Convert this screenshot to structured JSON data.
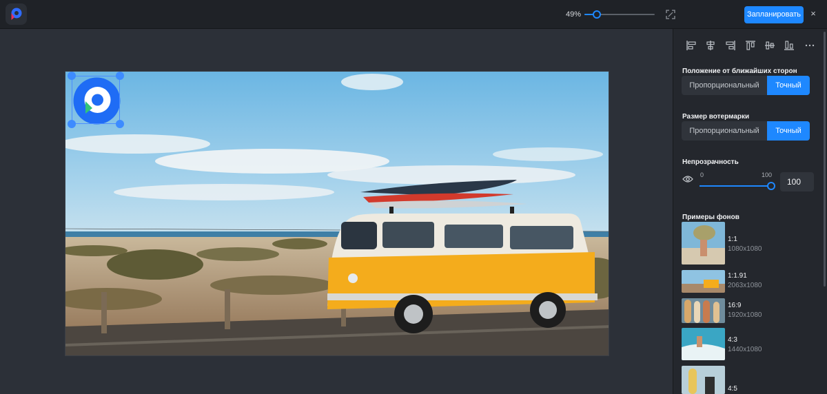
{
  "topbar": {
    "zoom": "49%",
    "zoom_fraction": 0.18,
    "schedule_label": "Запланировать",
    "close_label": "×"
  },
  "panel": {
    "position_title": "Положение от ближайших сторон",
    "position_options": [
      "Пропорциональный",
      "Точный"
    ],
    "position_selected": "Точный",
    "size_title": "Размер вотермарки",
    "size_options": [
      "Пропорциональный",
      "Точный"
    ],
    "size_selected": "Точный",
    "opacity_title": "Непрозрачность",
    "opacity_min": "0",
    "opacity_max": "100",
    "opacity_value": "100",
    "samples_title": "Примеры фонов",
    "samples": [
      {
        "ratio": "1:1",
        "dims": "1080x1080"
      },
      {
        "ratio": "1:1.91",
        "dims": "2063x1080"
      },
      {
        "ratio": "16:9",
        "dims": "1920x1080"
      },
      {
        "ratio": "4:3",
        "dims": "1440x1080"
      },
      {
        "ratio": "4:5",
        "dims": ""
      }
    ]
  },
  "colors": {
    "accent": "#1e88ff",
    "panel_bg": "#24272d",
    "canvas_bg": "#2c3038"
  },
  "icons": [
    "app-logo-icon",
    "fit-screen-icon",
    "close-icon",
    "align-left-icon",
    "align-center-h-icon",
    "align-right-icon",
    "align-top-icon",
    "align-middle-v-icon",
    "align-bottom-icon",
    "more-icon",
    "eye-icon"
  ]
}
